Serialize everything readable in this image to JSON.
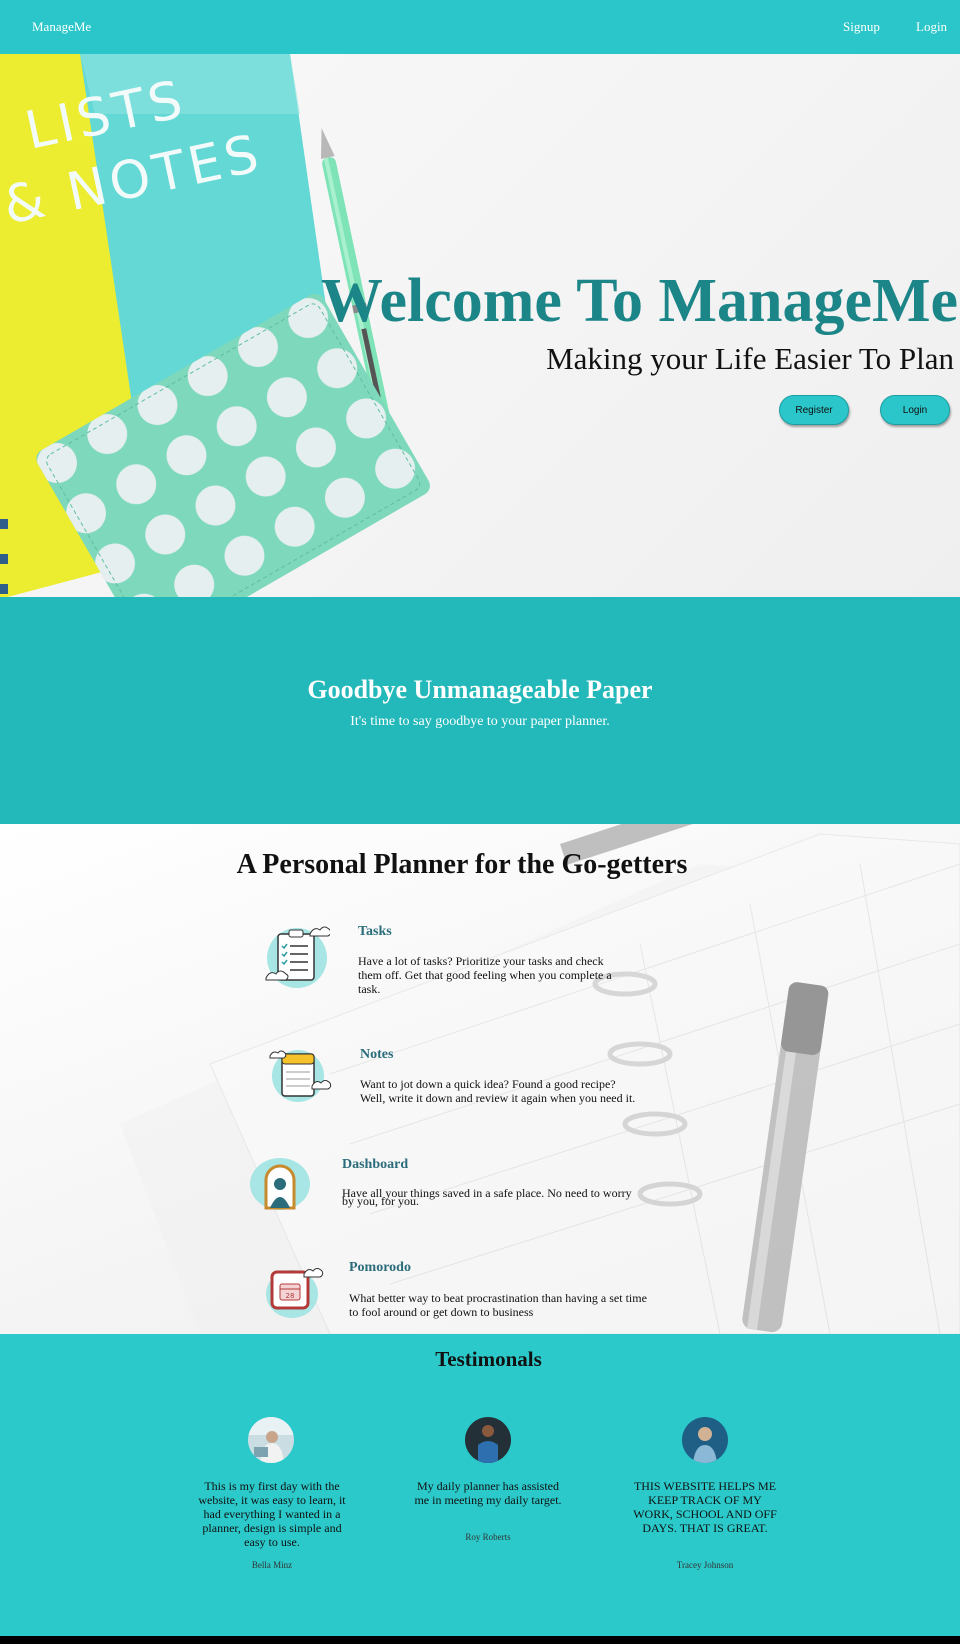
{
  "nav": {
    "brand": "ManageMe",
    "signup": "Signup",
    "login": "Login"
  },
  "hero": {
    "title": "Welcome To ManageMe",
    "subtitle": "Making your Life Easier To Plan",
    "register_button": "Register",
    "login_button": "Login",
    "notebook_text_line1": "LISTS",
    "notebook_text_line2": "& NOTES"
  },
  "goodbye": {
    "title": "Goodbye Unmanageable Paper",
    "text": "It's time to say goodbye to your paper planner."
  },
  "planner": {
    "title": "A Personal Planner for the Go-getters",
    "features": [
      {
        "name": "Tasks",
        "icon": "clipboard-checklist-icon",
        "desc": "Have a lot of tasks? Prioritize your tasks and check them off. Get that good feeling when you complete a task."
      },
      {
        "name": "Notes",
        "icon": "notepad-icon",
        "desc": "Want to jot down a quick idea? Found a good recipe? Well, write it down and review it again when you need it."
      },
      {
        "name": "Dashboard",
        "icon": "person-in-door-icon",
        "desc": "Have all your things saved in a safe place. No need to worry by you, for you."
      },
      {
        "name": "Pomorodo",
        "icon": "calendar-timer-icon",
        "desc": "What better way to beat procrastination than having a set time to fool around or get down to business"
      }
    ]
  },
  "testimonials": {
    "title": "Testimonals",
    "items": [
      {
        "text": "This is my first day with the website, it was easy to learn, it had everything I wanted in a planner, design is simple and easy to use.",
        "name": "Bella Minz"
      },
      {
        "text": "My daily planner has assisted me in meeting my daily target.",
        "name": "Roy Roberts"
      },
      {
        "text": "THIS WEBSITE HELPS ME KEEP TRACK OF MY WORK, SCHOOL AND OFF DAYS. THAT IS GREAT.",
        "name": "Tracey Johnson"
      }
    ]
  },
  "colors": {
    "teal": "#2bc6c9",
    "dark_teal": "#1c8588",
    "feature_title": "#2a6c7a"
  }
}
